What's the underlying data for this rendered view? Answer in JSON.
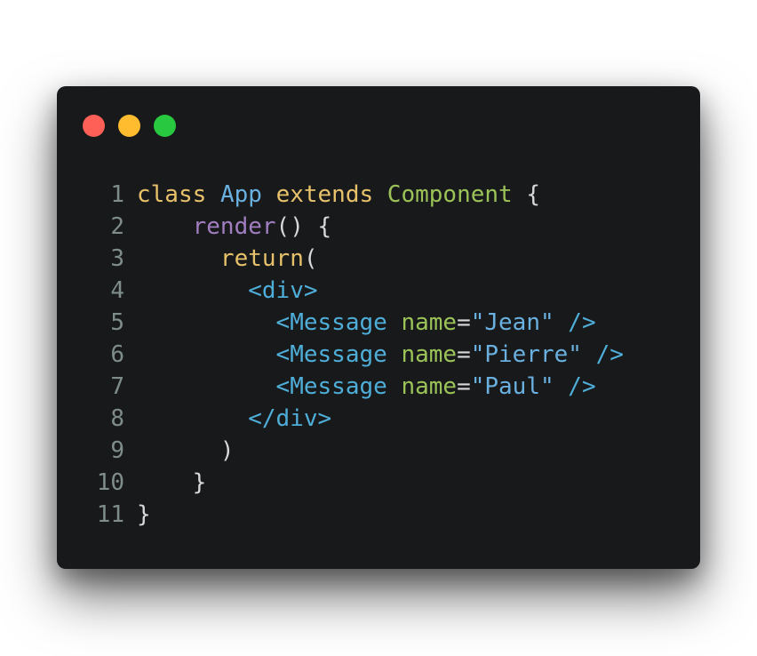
{
  "window": {
    "traffic_lights": [
      {
        "name": "close",
        "color": "#fe5f57"
      },
      {
        "name": "minimize",
        "color": "#febc2e"
      },
      {
        "name": "zoom",
        "color": "#28c840"
      }
    ]
  },
  "colors": {
    "keyword": "#e8c16b",
    "class_name": "#6ab0e0",
    "superclass": "#9bc358",
    "method": "#a07ec0",
    "tag": "#4faed8",
    "attr": "#9bc358",
    "punct": "#d8d8d8",
    "line_number": "#7f8d8a"
  },
  "code": {
    "lines": [
      {
        "num": "1",
        "tokens": [
          {
            "t": "class",
            "c": "keyword"
          },
          {
            "t": " ",
            "c": "punct"
          },
          {
            "t": "App",
            "c": "class_name"
          },
          {
            "t": " ",
            "c": "punct"
          },
          {
            "t": "extends",
            "c": "keyword"
          },
          {
            "t": " ",
            "c": "punct"
          },
          {
            "t": "Component",
            "c": "superclass"
          },
          {
            "t": " {",
            "c": "punct"
          }
        ]
      },
      {
        "num": "2",
        "tokens": [
          {
            "t": "    ",
            "c": "punct"
          },
          {
            "t": "render",
            "c": "method"
          },
          {
            "t": "() {",
            "c": "punct"
          }
        ]
      },
      {
        "num": "3",
        "tokens": [
          {
            "t": "      ",
            "c": "punct"
          },
          {
            "t": "return",
            "c": "keyword"
          },
          {
            "t": "(",
            "c": "punct"
          }
        ]
      },
      {
        "num": "4",
        "tokens": [
          {
            "t": "        ",
            "c": "punct"
          },
          {
            "t": "<div>",
            "c": "tag"
          }
        ]
      },
      {
        "num": "5",
        "tokens": [
          {
            "t": "          ",
            "c": "punct"
          },
          {
            "t": "<Message",
            "c": "tag"
          },
          {
            "t": " ",
            "c": "punct"
          },
          {
            "t": "name",
            "c": "attr"
          },
          {
            "t": "=",
            "c": "punct"
          },
          {
            "t": "\"Jean\"",
            "c": "class_name"
          },
          {
            "t": " ",
            "c": "punct"
          },
          {
            "t": "/>",
            "c": "tag"
          }
        ]
      },
      {
        "num": "6",
        "tokens": [
          {
            "t": "          ",
            "c": "punct"
          },
          {
            "t": "<Message",
            "c": "tag"
          },
          {
            "t": " ",
            "c": "punct"
          },
          {
            "t": "name",
            "c": "attr"
          },
          {
            "t": "=",
            "c": "punct"
          },
          {
            "t": "\"Pierre\"",
            "c": "class_name"
          },
          {
            "t": " ",
            "c": "punct"
          },
          {
            "t": "/>",
            "c": "tag"
          }
        ]
      },
      {
        "num": "7",
        "tokens": [
          {
            "t": "          ",
            "c": "punct"
          },
          {
            "t": "<Message",
            "c": "tag"
          },
          {
            "t": " ",
            "c": "punct"
          },
          {
            "t": "name",
            "c": "attr"
          },
          {
            "t": "=",
            "c": "punct"
          },
          {
            "t": "\"Paul\"",
            "c": "class_name"
          },
          {
            "t": " ",
            "c": "punct"
          },
          {
            "t": "/>",
            "c": "tag"
          }
        ]
      },
      {
        "num": "8",
        "tokens": [
          {
            "t": "        ",
            "c": "punct"
          },
          {
            "t": "</div>",
            "c": "tag"
          }
        ]
      },
      {
        "num": "9",
        "tokens": [
          {
            "t": "      )",
            "c": "punct"
          }
        ]
      },
      {
        "num": "10",
        "tokens": [
          {
            "t": "    }",
            "c": "punct"
          }
        ]
      },
      {
        "num": "11",
        "tokens": [
          {
            "t": "}",
            "c": "punct"
          }
        ]
      }
    ]
  }
}
